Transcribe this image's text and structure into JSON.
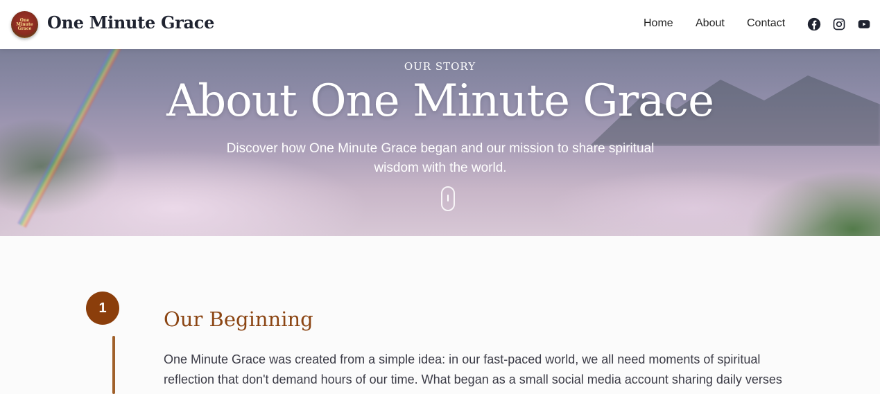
{
  "header": {
    "logo_text": "One Minute Grace",
    "brand": "One Minute Grace",
    "nav": [
      "Home",
      "About",
      "Contact"
    ],
    "social": [
      "facebook-icon",
      "instagram-icon",
      "youtube-icon"
    ]
  },
  "hero": {
    "eyebrow": "OUR STORY",
    "title": "About One Minute Grace",
    "subtitle": "Discover how One Minute Grace began and our mission to share spiritual wisdom with the world."
  },
  "section": {
    "step": "1",
    "title": "Our Beginning",
    "body": "One Minute Grace was created from a simple idea: in our fast-paced world, we all need moments of spiritual reflection that don't demand hours of our time. What began as a small social media account sharing daily verses"
  },
  "colors": {
    "accent": "#8b3e0b",
    "title_brown": "#8b4513"
  }
}
